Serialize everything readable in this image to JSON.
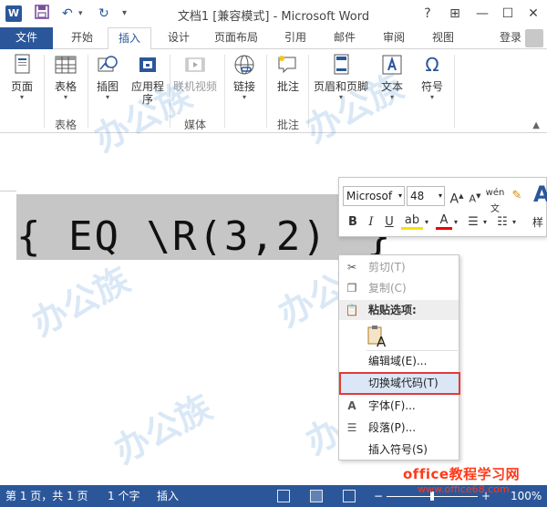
{
  "titlebar": {
    "title": "文档1 [兼容模式] - Microsoft Word",
    "logo_letter": "W",
    "buttons": {
      "help": "?",
      "ribbon_display": "⊞",
      "minimize": "—",
      "restore": "☐",
      "close": "✕"
    }
  },
  "tabs": {
    "file": "文件",
    "items": [
      "开始",
      "插入",
      "设计",
      "页面布局",
      "引用",
      "邮件",
      "审阅",
      "视图"
    ],
    "active": "插入",
    "login": "登录"
  },
  "ribbon": {
    "buttons": {
      "pages": "页面",
      "table": "表格",
      "illustrations": "插图",
      "apps_line1": "应用程",
      "apps_line2": "序",
      "online_video": "联机视频",
      "links": "链接",
      "comment": "批注",
      "header_footer": "页眉和页脚",
      "text": "文本",
      "symbols": "符号"
    },
    "groups": {
      "tables": "表格",
      "media": "媒体",
      "comments": "批注"
    }
  },
  "document": {
    "field_code": "{ EQ \\R(3,2) ",
    "closing_brace": "}"
  },
  "mini_toolbar": {
    "font": "Microsof",
    "size": "48",
    "styles_label": "样"
  },
  "context_menu": {
    "cut": "剪切(T)",
    "copy": "复制(C)",
    "paste_options": "粘贴选项:",
    "edit_field": "编辑域(E)...",
    "toggle_field_codes": "切换域代码(T)",
    "font": "字体(F)...",
    "paragraph": "段落(P)...",
    "insert_symbol": "插入符号(S)"
  },
  "statusbar": {
    "page": "第 1 页，共 1 页",
    "words": "1 个字",
    "mode": "插入",
    "zoom": "100%"
  },
  "watermark": {
    "brand": "office教程学习网",
    "url": "www.office68.com"
  },
  "colors": {
    "accent": "#2b579a",
    "field_shading": "#c6c6c6",
    "highlight_border": "#e23a3a",
    "watermark_brand": "#ff3a1a"
  }
}
